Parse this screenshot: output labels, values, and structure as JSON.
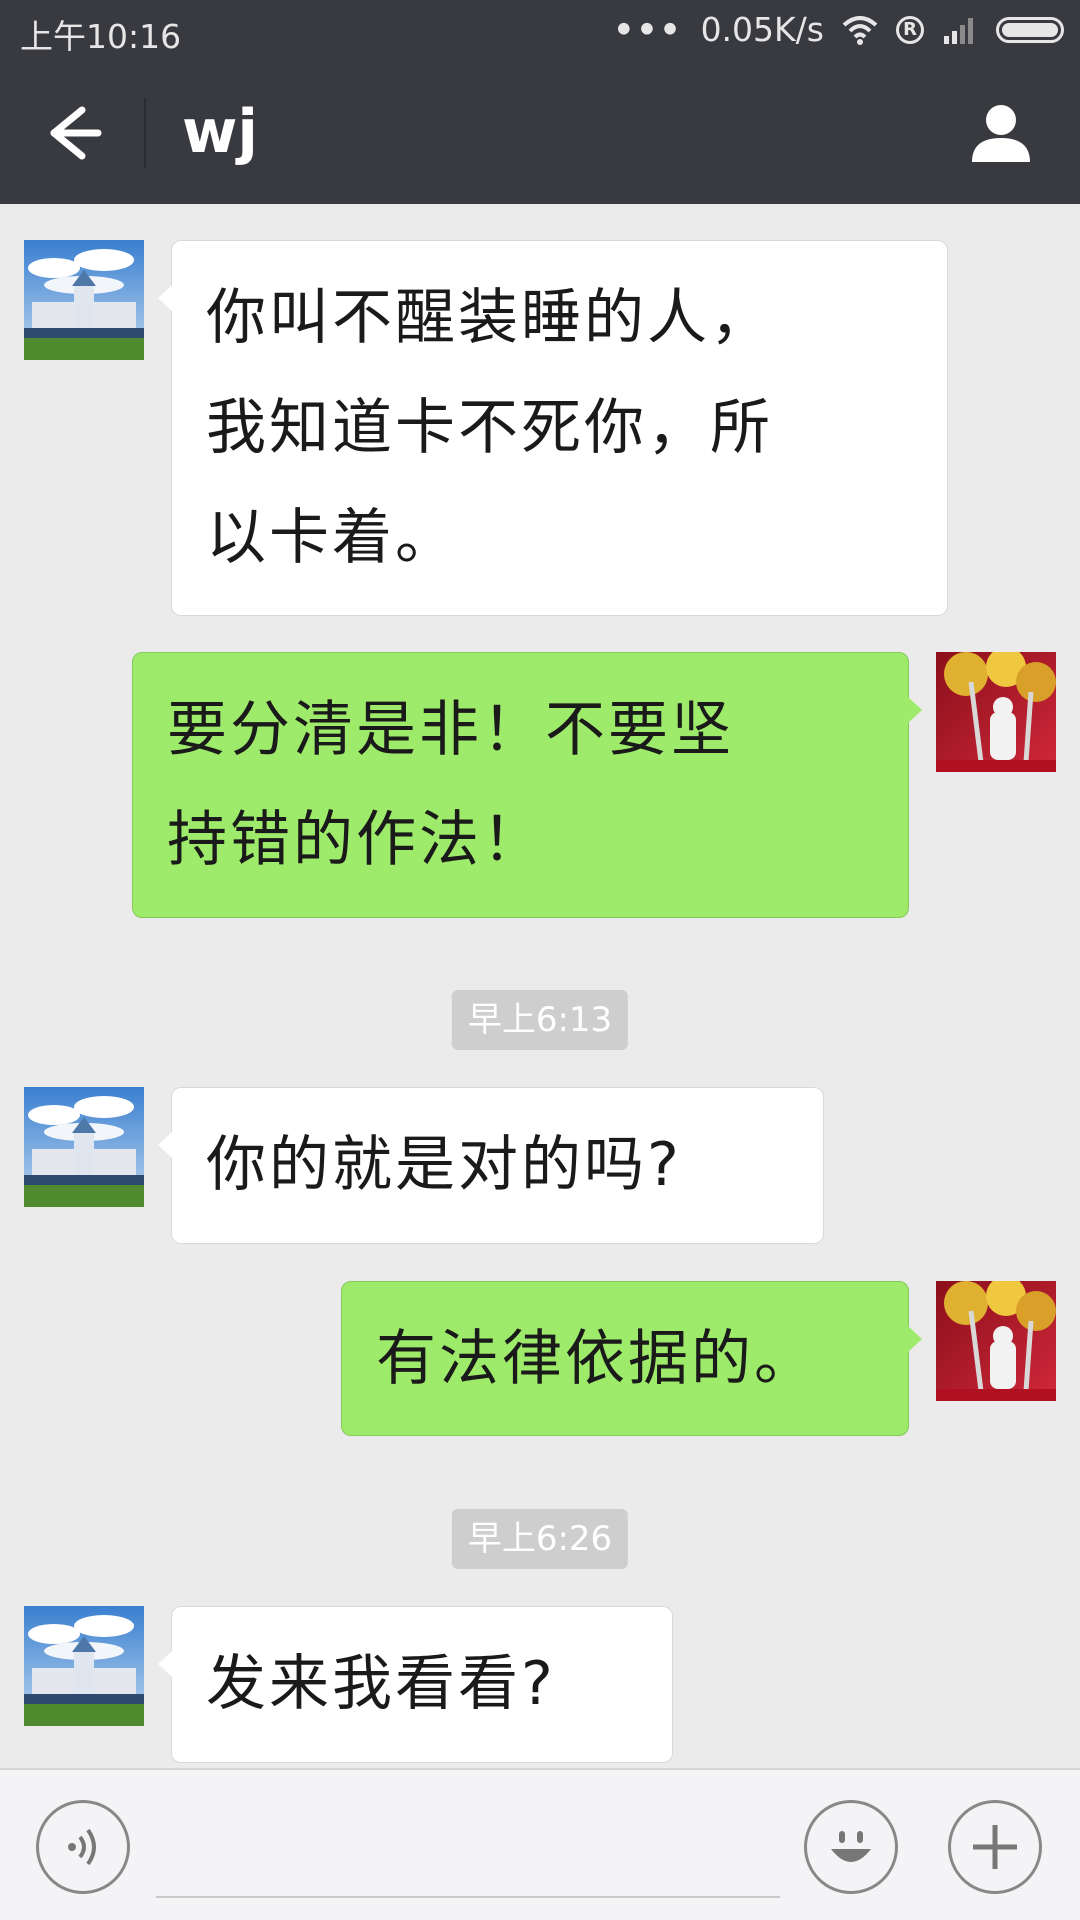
{
  "status_bar": {
    "time": "上午10:16",
    "dots": "•••",
    "speed": "0.05K/s",
    "reg_mark": "R"
  },
  "header": {
    "title": "wj",
    "back_icon": "arrow-left-icon",
    "profile_icon": "person-icon"
  },
  "messages": [
    {
      "side": "left",
      "lines": [
        "你叫不醒装睡的人，",
        "我知道卡不死你，所",
        "以卡着。"
      ]
    },
    {
      "side": "right",
      "lines": [
        "要分清是非！不要坚",
        "持错的作法！"
      ]
    },
    {
      "timestamp": "早上6:13"
    },
    {
      "side": "left",
      "lines": [
        "你的就是对的吗?"
      ]
    },
    {
      "side": "right",
      "lines": [
        "有法律依据的。"
      ]
    },
    {
      "timestamp": "早上6:26"
    },
    {
      "side": "left",
      "lines": [
        "发来我看看?"
      ]
    }
  ],
  "bottom_bar": {
    "voice_icon": "voice-icon",
    "emoji_icon": "smiley-icon",
    "plus_icon": "plus-icon",
    "input_value": ""
  },
  "colors": {
    "bar": "#393a3f",
    "chat_bg": "#ebebeb",
    "bubble_self": "#9eea6a",
    "bubble_other": "#ffffff"
  }
}
